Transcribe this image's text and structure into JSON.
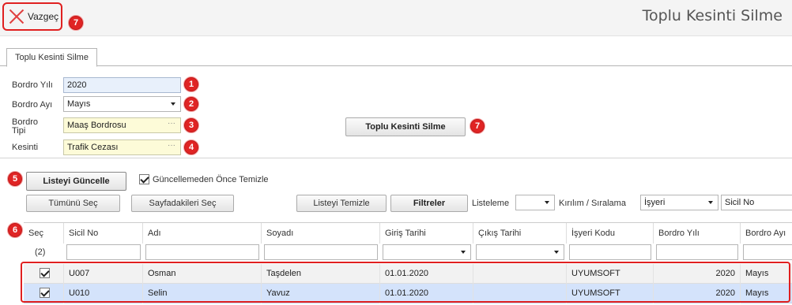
{
  "topbar": {
    "cancel_label": "Vazgeç",
    "page_title": "Toplu Kesinti Silme"
  },
  "tabs": [
    {
      "label": "Toplu Kesinti Silme"
    }
  ],
  "badges": {
    "b1": "1",
    "b2": "2",
    "b3": "3",
    "b4": "4",
    "b5": "5",
    "b6": "6",
    "b7": "7"
  },
  "form": {
    "bordro_yili_label": "Bordro Yılı",
    "bordro_yili_value": "2020",
    "bordro_ayi_label": "Bordro Ayı",
    "bordro_ayi_value": "Mayıs",
    "bordro_tipi_label_1": "Bordro",
    "bordro_tipi_label_2": "Tipi",
    "bordro_tipi_value": "Maaş Bordrosu",
    "kesinti_label": "Kesinti",
    "kesinti_value": "Trafik Cezası",
    "ellipsis": "···",
    "action_button": "Toplu Kesinti Silme"
  },
  "toolbar": {
    "refresh_button": "Listeyi Güncelle",
    "clear_before_update_label": "Güncellemeden Önce Temizle",
    "select_all_button": "Tümünü Seç",
    "select_page_button": "Sayfadakileri Seç",
    "clear_list_button": "Listeyi Temizle",
    "filters_button": "Filtreler",
    "listeleme_label": "Listeleme",
    "listeleme_value": "",
    "kirilim_label": "Kırılım / Sıralama",
    "kirilim_value": "İşyeri",
    "sort_value": "Sicil No"
  },
  "grid": {
    "columns": [
      "Seç",
      "Sicil No",
      "Adı",
      "Soyadı",
      "Giriş Tarihi",
      "Çıkış Tarihi",
      "İşyeri Kodu",
      "Bordro Yılı",
      "Bordro Ayı"
    ],
    "selected_count": "(2)",
    "rows": [
      {
        "checked": true,
        "sicil_no": "U007",
        "adi": "Osman",
        "soyadi": "Taşdelen",
        "giris": "01.01.2020",
        "cikis": "",
        "isyeri": "UYUMSOFT",
        "yil": "2020",
        "ay": "Mayıs"
      },
      {
        "checked": true,
        "sicil_no": "U010",
        "adi": "Selin",
        "soyadi": "Yavuz",
        "giris": "01.01.2020",
        "cikis": "",
        "isyeri": "UYUMSOFT",
        "yil": "2020",
        "ay": "Mayıs"
      }
    ]
  },
  "colors": {
    "badge_red": "#e02424",
    "selected_row": "#d4e3fb",
    "highlight_border": "#e02020"
  }
}
